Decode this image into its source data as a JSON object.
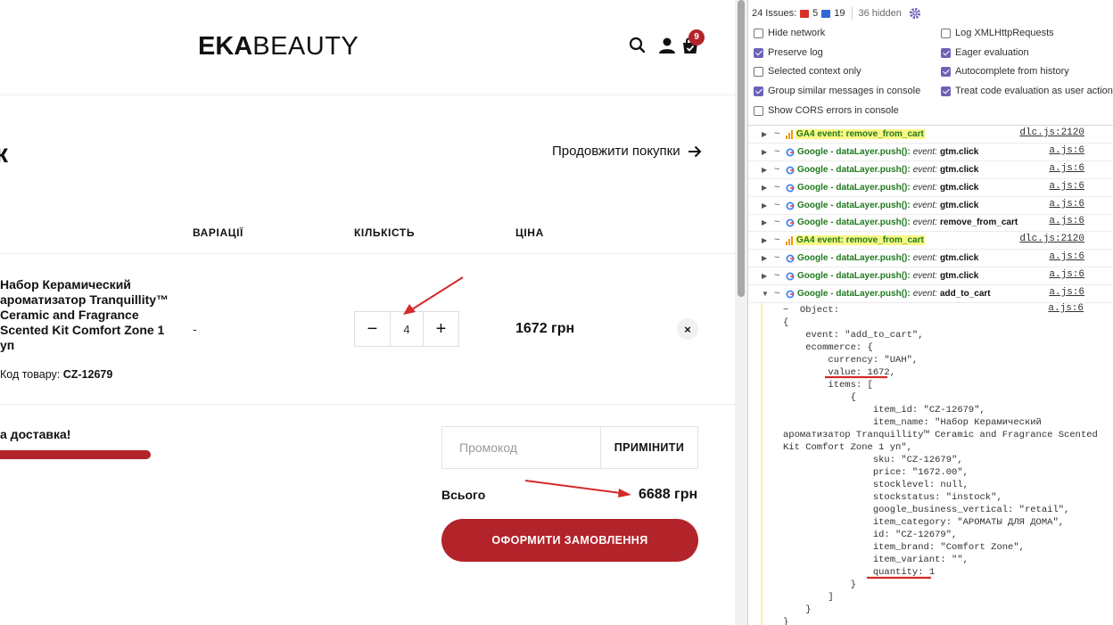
{
  "shop": {
    "logo_bold": "EKA",
    "logo_thin": "BEAUTY",
    "cart_count": "9",
    "title_fragment": "к",
    "continue_label": "Продовжити покупки",
    "columns": {
      "variations": "ВАРІАЦІЇ",
      "quantity": "КІЛЬКІСТЬ",
      "price": "ЦІНА"
    },
    "product": {
      "name": "Набор Керамический ароматизатор Tranquillity™ Ceramic and Fragrance Scented Kit Comfort Zone 1 уп",
      "code_label": "Код товару:",
      "code_value": "CZ-12679",
      "variation": "-",
      "quantity": "4",
      "minus": "−",
      "plus": "+",
      "price": "1672 грн",
      "remove": "×"
    },
    "shipping_text": "а доставка!",
    "promo_placeholder": "Промокод",
    "apply_label": "ПРИМІНИТИ",
    "total_label": "Всього",
    "total_value": "6688 грн",
    "checkout_label": "ОФОРМИТИ ЗАМОВЛЕННЯ",
    "accent_color": "#b3232a"
  },
  "devtools": {
    "issues_label": "24 Issues:",
    "errors": "5",
    "messages": "19",
    "hidden": "36 hidden",
    "options": [
      {
        "label": "Hide network",
        "checked": false
      },
      {
        "label": "Log XMLHttpRequests",
        "checked": false
      },
      {
        "label": "Preserve log",
        "checked": true
      },
      {
        "label": "Eager evaluation",
        "checked": true
      },
      {
        "label": "Selected context only",
        "checked": false
      },
      {
        "label": "Autocomplete from history",
        "checked": true
      },
      {
        "label": "Group similar messages in console",
        "checked": true
      },
      {
        "label": "Treat code evaluation as user action",
        "checked": true
      },
      {
        "label": "Show CORS errors in console",
        "checked": false
      }
    ],
    "logs": [
      {
        "kind": "ga4",
        "text": "GA4 event: remove_from_cart",
        "src": "dlc.js:2120"
      },
      {
        "kind": "gtm",
        "text": "Google - dataLayer.push():",
        "ev": "event:",
        "val": "gtm.click",
        "src": "a.js:6"
      },
      {
        "kind": "gtm",
        "text": "Google - dataLayer.push():",
        "ev": "event:",
        "val": "gtm.click",
        "src": "a.js:6"
      },
      {
        "kind": "gtm",
        "text": "Google - dataLayer.push():",
        "ev": "event:",
        "val": "gtm.click",
        "src": "a.js:6"
      },
      {
        "kind": "gtm",
        "text": "Google - dataLayer.push():",
        "ev": "event:",
        "val": "gtm.click",
        "src": "a.js:6"
      },
      {
        "kind": "gtm",
        "text": "Google - dataLayer.push():",
        "ev": "event:",
        "val": "remove_from_cart",
        "src": "a.js:6"
      },
      {
        "kind": "ga4",
        "text": "GA4 event: remove_from_cart",
        "src": "dlc.js:2120"
      },
      {
        "kind": "gtm",
        "text": "Google - dataLayer.push():",
        "ev": "event:",
        "val": "gtm.click",
        "src": "a.js:6"
      },
      {
        "kind": "gtm",
        "text": "Google - dataLayer.push():",
        "ev": "event:",
        "val": "gtm.click",
        "src": "a.js:6"
      },
      {
        "kind": "gtm",
        "text": "Google - dataLayer.push():",
        "ev": "event:",
        "val": "add_to_cart",
        "src": "a.js:6",
        "expanded": true
      }
    ],
    "object_src": "a.js:6",
    "object_lines": [
      "~  Object:",
      "{",
      "    event: \"add_to_cart\",",
      "    ecommerce: {",
      "        currency: \"UAH\",",
      "        value: 1672,",
      "        items: [",
      "            {",
      "                item_id: \"CZ-12679\",",
      "                item_name: \"Набор Керамический",
      "ароматизатор Tranquillity™ Ceramic and Fragrance Scented",
      "Kit Comfort Zone 1 уп\",",
      "                sku: \"CZ-12679\",",
      "                price: \"1672.00\",",
      "                stocklevel: null,",
      "                stockstatus: \"instock\",",
      "                google_business_vertical: \"retail\",",
      "                item_category: \"АРОМАТЫ ДЛЯ ДОМА\",",
      "                id: \"CZ-12679\",",
      "                item_brand: \"Comfort Zone\",",
      "                item_variant: \"\",",
      "                quantity: 1",
      "            }",
      "        ]",
      "    }",
      "}"
    ]
  }
}
